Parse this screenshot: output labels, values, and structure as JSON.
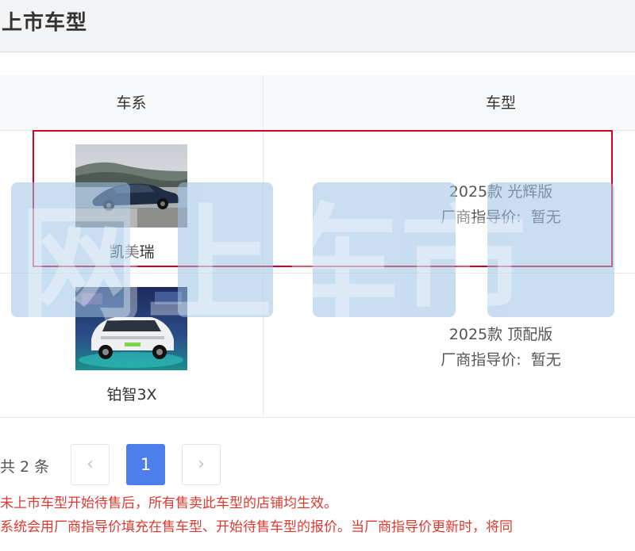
{
  "header": {
    "title": "上市车型"
  },
  "table": {
    "columns": {
      "series": "车系",
      "model": "车型"
    },
    "rows": [
      {
        "series": "凯美瑞",
        "model": "2025款 光辉版",
        "price_label": "厂商指导价:",
        "price_value": "暂无",
        "image": "dark-blue-sedan"
      },
      {
        "series": "铂智3X",
        "model": "2025款 顶配版",
        "price_label": "厂商指导价:",
        "price_value": "暂无",
        "image": "white-suv"
      }
    ]
  },
  "pagination": {
    "total_text": "共 2 条",
    "current_page": "1",
    "prev_icon": "chevron-left-icon",
    "next_icon": "chevron-right-icon"
  },
  "notes": [
    "未上市车型开始待售后，所有售卖此车型的店铺均生效。",
    "系统会用厂商指导价填充在售车型、开始待售车型的报价。当厂商指导价更新时，将同"
  ],
  "watermark": {
    "text": "网上车市"
  },
  "colors": {
    "highlight": "#d2001f",
    "accent": "#4e7ee9",
    "note": "#e0392f",
    "watermark": "#9ec3e6"
  }
}
